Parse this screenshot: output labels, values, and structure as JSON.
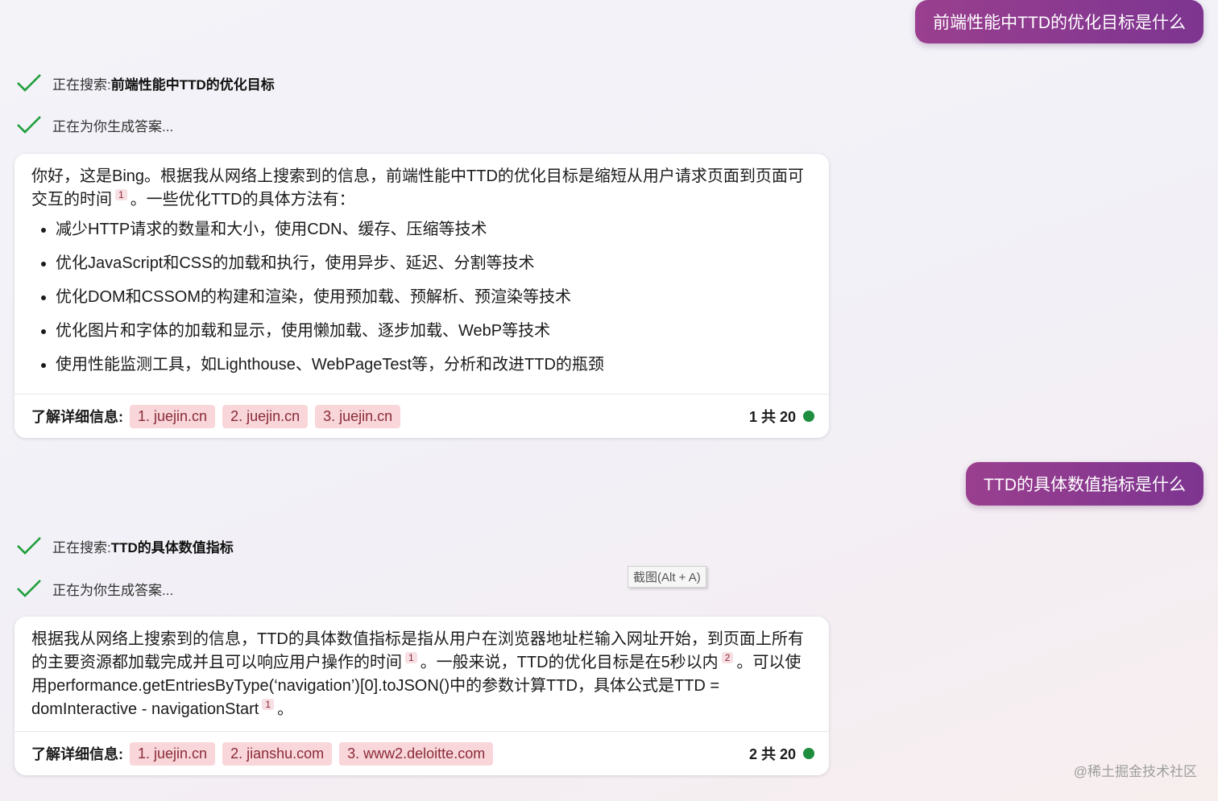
{
  "conversation": {
    "q1": "前端性能中TTD的优化目标是什么",
    "q2": "TTD的具体数值指标是什么",
    "status1": {
      "prefix": "正在搜索: ",
      "query": "前端性能中TTD的优化目标"
    },
    "status2": {
      "text": "正在为你生成答案..."
    },
    "status3": {
      "prefix": "正在搜索: ",
      "query": "TTD的具体数值指标"
    },
    "status4": {
      "text": "正在为你生成答案..."
    }
  },
  "answer1": {
    "intro_a": "你好，这是Bing。根据我从网络上搜索到的信息，前端性能中TTD的优化目标是缩短从用户请求页面到页面可交互的时间",
    "intro_ref": "1",
    "intro_b": "。一些优化TTD的具体方法有：",
    "bullets": [
      "减少HTTP请求的数量和大小，使用CDN、缓存、压缩等技术",
      "优化JavaScript和CSS的加载和执行，使用异步、延迟、分割等技术",
      "优化DOM和CSSOM的构建和渲染，使用预加载、预解析、预渲染等技术",
      "优化图片和字体的加载和显示，使用懒加载、逐步加载、WebP等技术",
      "使用性能监测工具，如Lighthouse、WebPageTest等，分析和改进TTD的瓶颈"
    ],
    "learn_more": "了解详细信息:",
    "sources": [
      "1. juejin.cn",
      "2. juejin.cn",
      "3. juejin.cn"
    ],
    "count": "1 共 20"
  },
  "answer2": {
    "p_a": "根据我从网络上搜索到的信息，TTD的具体数值指标是指从用户在浏览器地址栏输入网址开始，到页面上所有的主要资源都加载完成并且可以响应用户操作的时间",
    "ref1": "1",
    "p_b": "。一般来说，TTD的优化目标是在5秒以内",
    "ref2": "2",
    "p_c": "。可以使用performance.getEntriesByType(‘navigation’)[0].toJSON()中的参数计算TTD，具体公式是TTD = domInteractive - navigationStart",
    "ref3": "1",
    "p_d": "。",
    "learn_more": "了解详细信息:",
    "sources": [
      "1. juejin.cn",
      "2. jianshu.com",
      "3. www2.deloitte.com"
    ],
    "count": "2 共 20"
  },
  "tooltip": "截图(Alt + A)",
  "watermark": "@稀土掘金技术社区",
  "colors": {
    "accent": "#8a3a90",
    "check": "#1e9e3a",
    "source_bg": "#f8d6da",
    "dot": "#1e8e3e"
  }
}
